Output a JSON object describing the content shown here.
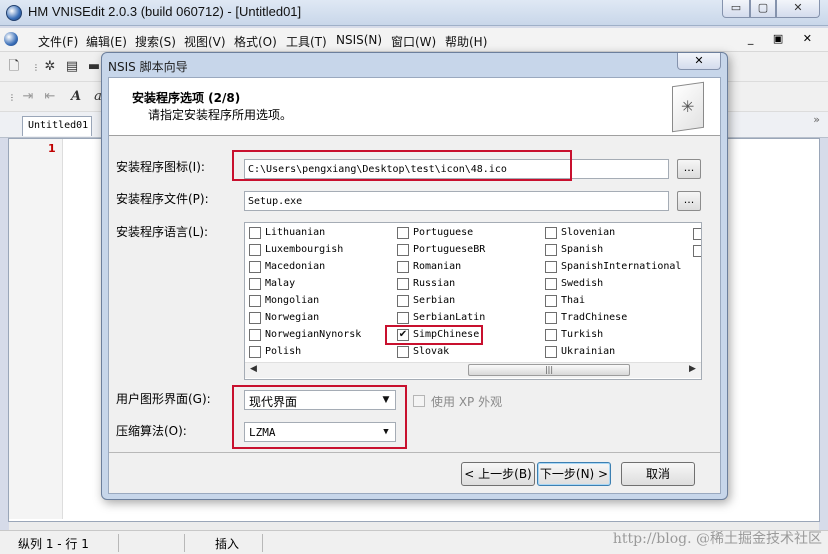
{
  "app": {
    "title": "HM VNISEdit 2.0.3 (build 060712) - [Untitled01]",
    "window_controls": [
      "▭",
      "▢",
      "✕"
    ],
    "mdi_controls": "_ ▣ ✕"
  },
  "menu": [
    "文件(F)",
    "编辑(E)",
    "搜索(S)",
    "视图(V)",
    "格式(O)",
    "工具(T)",
    "NSIS(N)",
    "窗口(W)",
    "帮助(H)"
  ],
  "editor": {
    "tab_label": "Untitled01",
    "line_number": "1",
    "tab_scroll": "»"
  },
  "status": {
    "position": "纵列 1 - 行 1",
    "mode": "插入"
  },
  "watermark": "http://blog. @稀土掘金技术社区",
  "wizard": {
    "title": "NSIS 脚本向导",
    "close": "✕",
    "heading": "安装程序选项 (2/8)",
    "subheading": "请指定安装程序所用选项。",
    "icon_label": "安装程序图标(I):",
    "icon_value": "C:\\Users\\pengxiang\\Desktop\\test\\icon\\48.ico",
    "file_label": "安装程序文件(P):",
    "file_value": "Setup.exe",
    "browse": "...",
    "language_label": "安装程序语言(L):",
    "languages": [
      [
        {
          "name": "Lithuanian",
          "checked": false
        },
        {
          "name": "Luxembourgish",
          "checked": false
        },
        {
          "name": "Macedonian",
          "checked": false
        },
        {
          "name": "Malay",
          "checked": false
        },
        {
          "name": "Mongolian",
          "checked": false
        },
        {
          "name": "Norwegian",
          "checked": false
        },
        {
          "name": "NorwegianNynorsk",
          "checked": false
        },
        {
          "name": "Polish",
          "checked": false
        }
      ],
      [
        {
          "name": "Portuguese",
          "checked": false
        },
        {
          "name": "PortugueseBR",
          "checked": false
        },
        {
          "name": "Romanian",
          "checked": false
        },
        {
          "name": "Russian",
          "checked": false
        },
        {
          "name": "Serbian",
          "checked": false
        },
        {
          "name": "SerbianLatin",
          "checked": false
        },
        {
          "name": "SimpChinese",
          "checked": true
        },
        {
          "name": "Slovak",
          "checked": false
        }
      ],
      [
        {
          "name": "Slovenian",
          "checked": false
        },
        {
          "name": "Spanish",
          "checked": false
        },
        {
          "name": "SpanishInternational",
          "checked": false
        },
        {
          "name": "Swedish",
          "checked": false
        },
        {
          "name": "Thai",
          "checked": false
        },
        {
          "name": "TradChinese",
          "checked": false
        },
        {
          "name": "Turkish",
          "checked": false
        },
        {
          "name": "Ukrainian",
          "checked": false
        }
      ]
    ],
    "gui_label": "用户图形界面(G):",
    "gui_value": "现代界面",
    "xp_style_label": "使用 XP 外观",
    "xp_style_checked": false,
    "compression_label": "压缩算法(O):",
    "compression_value": "LZMA",
    "back_button": "< 上一步(B)",
    "next_button": "下一步(N) >",
    "cancel_button": "取消",
    "highlight_color": "#c8102e"
  }
}
